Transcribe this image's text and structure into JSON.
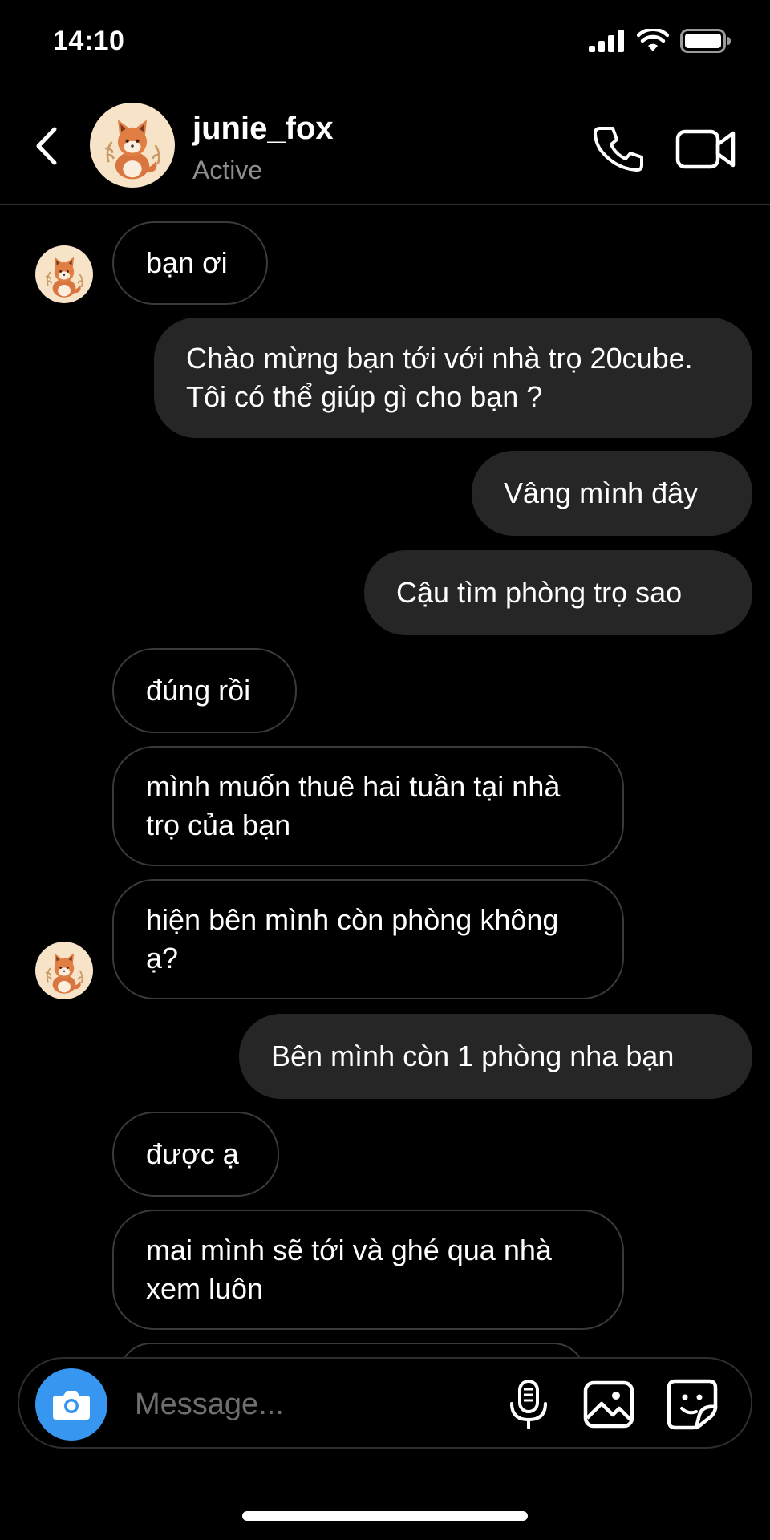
{
  "status_bar": {
    "time": "14:10"
  },
  "header": {
    "username": "junie_fox",
    "status": "Active"
  },
  "messages": [
    {
      "from": "other",
      "text": "bạn ơi"
    },
    {
      "from": "me",
      "text": "Chào mừng bạn tới với nhà trọ 20cube. Tôi có thể giúp gì cho bạn ?"
    },
    {
      "from": "me",
      "text": "Vâng mình đây"
    },
    {
      "from": "me",
      "text": "Cậu tìm phòng trọ sao"
    },
    {
      "from": "other",
      "text": "đúng rồi"
    },
    {
      "from": "other",
      "text": "mình muốn thuê hai tuần tại nhà trọ của bạn"
    },
    {
      "from": "other",
      "text": "hiện bên mình còn phòng không ạ?"
    },
    {
      "from": "me",
      "text": "Bên mình còn 1 phòng nha bạn"
    },
    {
      "from": "other",
      "text": "được ạ"
    },
    {
      "from": "other",
      "text": "mai mình sẽ tới và ghé qua nhà xem luôn"
    }
  ],
  "composer": {
    "placeholder": "Message..."
  },
  "colors": {
    "accent": "#3797f0",
    "outgoing_bubble": "#262626",
    "incoming_border": "#3a3a3a",
    "secondary_text": "#8e8e8e"
  },
  "icons": [
    "signal-icon",
    "wifi-icon",
    "battery-icon",
    "back-arrow-icon",
    "phone-icon",
    "video-camera-icon",
    "camera-icon",
    "microphone-icon",
    "gallery-icon",
    "sticker-icon"
  ]
}
